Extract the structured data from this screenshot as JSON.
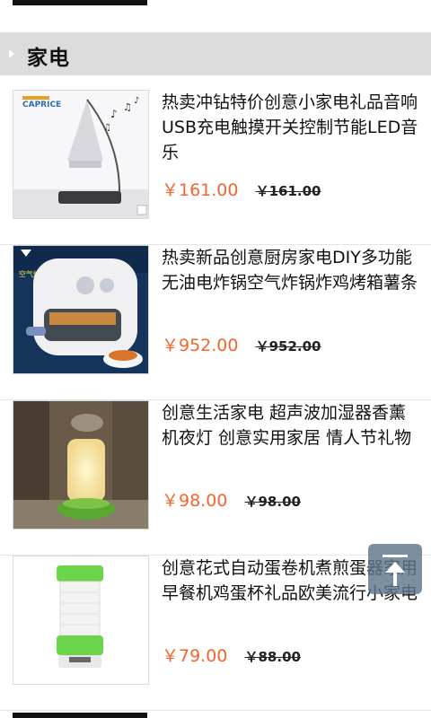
{
  "section": {
    "title": "家电"
  },
  "products": [
    {
      "name": "热卖冲钻特价创意小家电礼品音响USB充电触摸开关控制节能LED音乐",
      "price": "￥161.00",
      "old_price": "￥161.00",
      "image": "touch-lamp-speaker",
      "brand_logo_text": "CAPRICE"
    },
    {
      "name": "热卖新品创意厨房家电DIY多功能无油电炸锅空气炸锅炸鸡烤箱薯条",
      "price": "￥952.00",
      "old_price": "￥952.00",
      "image": "air-fryer",
      "brand_logo_text": "空气炸锅"
    },
    {
      "name": "创意生活家电 超声波加湿器香薰机夜灯 创意实用家居 情人节礼物",
      "price": "￥98.00",
      "old_price": "￥98.00",
      "image": "humidifier-night-light"
    },
    {
      "name": "创意花式自动蛋卷机煮煎蛋器家用早餐机鸡蛋杯礼品欧美流行小家电",
      "price": "￥79.00",
      "old_price": "￥88.00",
      "image": "egg-roll-maker"
    }
  ],
  "colors": {
    "price": "#f2652e",
    "header_bg": "#dcdcdc",
    "back_to_top": "#5f768c"
  },
  "icons": {
    "back_to_top": "arrow-up-to-top-icon",
    "section_marker": "triangle-right-icon"
  }
}
